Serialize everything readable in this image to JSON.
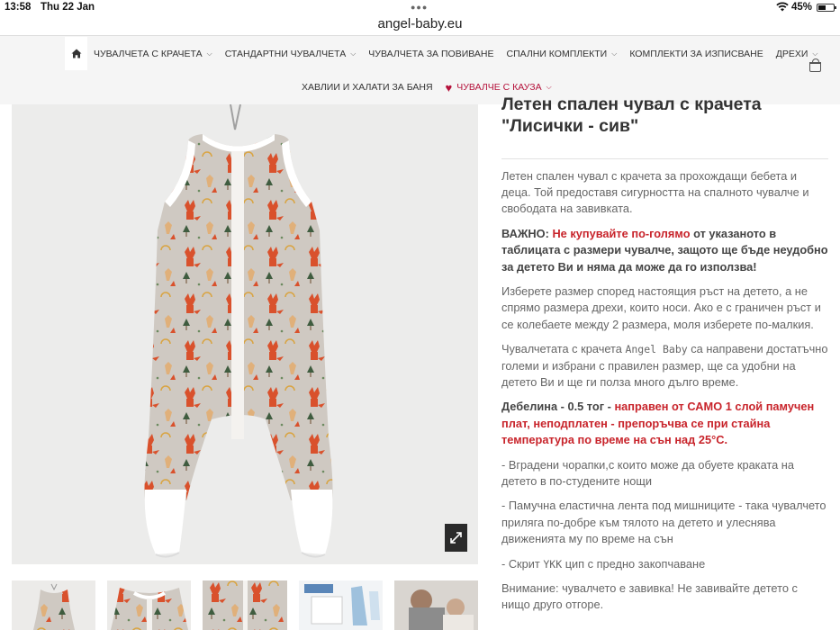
{
  "status_bar": {
    "time": "13:58",
    "date": "Thu 22 Jan",
    "battery": "45%"
  },
  "browser": {
    "url": "angel-baby.eu"
  },
  "nav": {
    "home_icon": "home-icon",
    "items": [
      {
        "label": "ЧУВАЛЧЕТА С КРАЧЕТА",
        "has_dropdown": true
      },
      {
        "label": "СТАНДАРТНИ ЧУВАЛЧЕТА",
        "has_dropdown": true
      },
      {
        "label": "ЧУВАЛЧЕТА ЗА ПОВИВАНЕ",
        "has_dropdown": false
      },
      {
        "label": "СПАЛНИ КОМПЛЕКТИ",
        "has_dropdown": true
      },
      {
        "label": "КОМПЛЕКТИ ЗА ИЗПИСВАНЕ",
        "has_dropdown": false
      },
      {
        "label": "ДРЕХИ",
        "has_dropdown": true
      }
    ],
    "row2": [
      {
        "label": "ХАВЛИИ И ХАЛАТИ ЗА БАНЯ",
        "has_dropdown": false
      },
      {
        "label": "ЧУВАЛЧЕ С КАУЗА",
        "has_dropdown": true,
        "icon": "heart-icon"
      }
    ],
    "cart_icon": "shopping-bag-icon",
    "accent_color": "#b5123b"
  },
  "product": {
    "title_line1": "Летен спален чувал с крачета",
    "title_line2": "\"Лисички - сив\"",
    "zoom_icon": "expand-icon",
    "thumbnail_count": 5,
    "description": {
      "p1": "Летен спален чувал с крачета за прохождащи бебета и деца. Той предоставя сигурността на спалното чувалче и свободата на завивката.",
      "p2_label": "ВАЖНО:",
      "p2_red": "Не купувайте по-голямо",
      "p2_rest": "от указаното в таблицата с размери чувалче, защото ще бъде неудобно за детето Ви и няма да може да го използва!",
      "p3": "Изберете размер според настоящия ръст на детето, а не спрямо размера дрехи, които носи. Ако е с граничен ръст и се колебаете между 2 размера, моля изберете по-малкия.",
      "p4_a": "Чувалчетата с крачета",
      "p4_brand": "Angel Baby",
      "p4_b": "са направени достатъчно големи и избрани с правилен размер, ще са удобни на детето Ви и ще ги полза много дълго време.",
      "p5_label": "Дебелина - 0.5 тог",
      "p5_dash": " - ",
      "p5_red": "направен от САМО 1 слой памучен плат, неподплатен - препоръчва се при стайна температура по време на сън над 25°С.",
      "p6": "- Вградени чорапки,с които може да обуете краката на детето в по-студените нощи",
      "p7": "- Памучна еластична лента под мишниците - така чувалчето приляга по-добре към тялото на детето и улеснява движенията му по време на сън",
      "p8_a": "- Скрит",
      "p8_brand": "YKK",
      "p8_b": "цип с предно закопчаване",
      "p9": "Внимание: чувалчето е завивка!  Не завивайте детето с нищо друго отгоре."
    }
  },
  "colors": {
    "red_text": "#c8242b",
    "header_bg": "#f5f5f5"
  }
}
